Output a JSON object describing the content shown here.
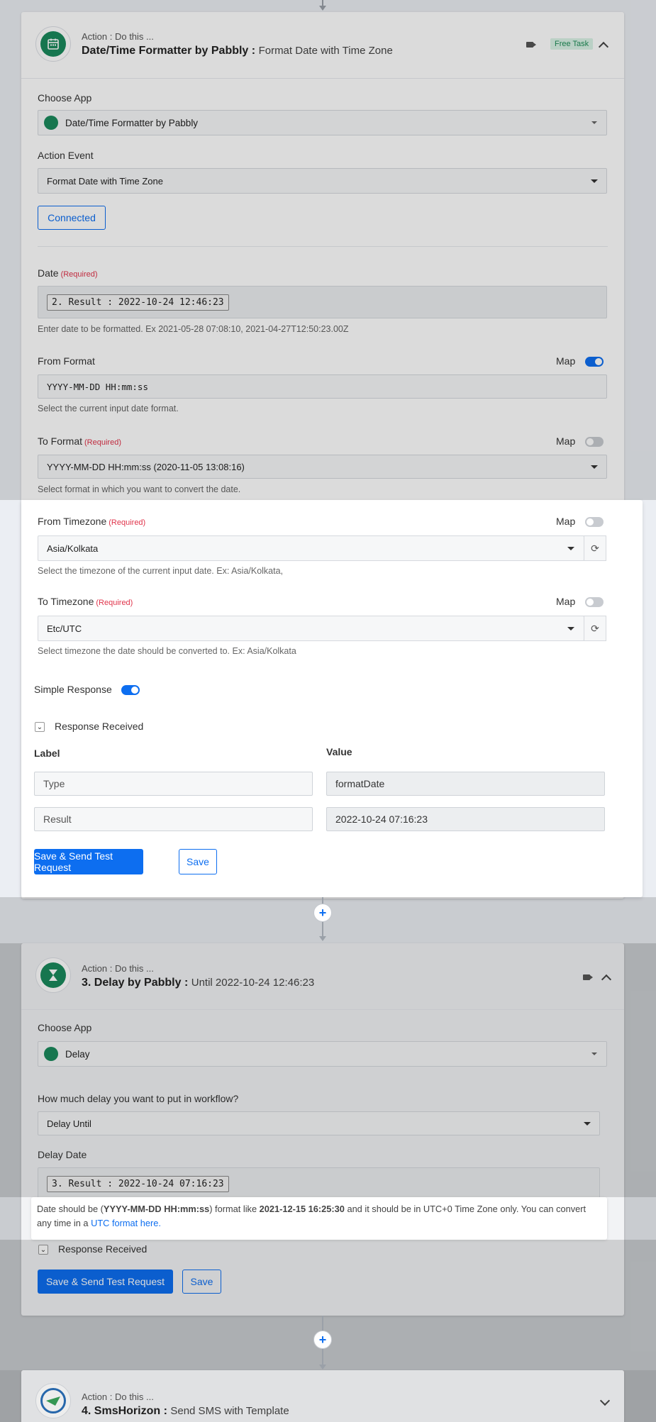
{
  "step1": {
    "subtitle": "Action : Do this ...",
    "title": "Date/Time Formatter by Pabbly :",
    "title_detail": "Format Date with Time Zone",
    "free_task": "Free Task",
    "choose_app_label": "Choose App",
    "app_name": "Date/Time Formatter by Pabbly",
    "action_event_label": "Action Event",
    "action_event_value": "Format Date with Time Zone",
    "connected_label": "Connected",
    "date_label": "Date",
    "required": "(Required)",
    "date_token": "2. Result : 2022-10-24 12:46:23",
    "date_help": "Enter date to be formatted. Ex 2021-05-28 07:08:10, 2021-04-27T12:50:23.00Z",
    "from_format_label": "From Format",
    "map_label": "Map",
    "from_format_value": "YYYY-MM-DD HH:mm:ss",
    "from_format_help": "Select the current input date format.",
    "to_format_label": "To Format",
    "to_format_value": "YYYY-MM-DD HH:mm:ss (2020-11-05 13:08:16)",
    "to_format_help": "Select format in which you want to convert the date.",
    "from_tz_label": "From Timezone",
    "from_tz_value": "Asia/Kolkata",
    "from_tz_help": "Select the timezone of the current input date. Ex: Asia/Kolkata,",
    "to_tz_label": "To Timezone",
    "to_tz_value": "Etc/UTC",
    "to_tz_help": "Select timezone the date should be converted to. Ex: Asia/Kolkata",
    "simple_response_label": "Simple Response",
    "response_received_label": "Response Received",
    "col_label": "Label",
    "col_value": "Value",
    "rows": [
      {
        "label": "Type",
        "value": "formatDate"
      },
      {
        "label": "Result",
        "value": "2022-10-24 07:16:23"
      }
    ],
    "save_send_label": "Save & Send Test Request",
    "save_label": "Save"
  },
  "step2": {
    "subtitle": "Action : Do this ...",
    "title": "3. Delay by Pabbly :",
    "title_detail": "Until 2022-10-24 12:46:23",
    "choose_app_label": "Choose App",
    "app_name": "Delay",
    "question_label": "How much delay you want to put in workflow?",
    "delay_type_value": "Delay Until",
    "delay_date_label": "Delay Date",
    "delay_date_token": "3. Result : 2022-10-24 07:16:23",
    "note_prefix": "Date should be (",
    "note_format": "YYYY-MM-DD HH:mm:ss",
    "note_mid": ") format like ",
    "note_example": "2021-12-15 16:25:30",
    "note_suffix": " and it should be in UTC+0 Time Zone only. You can convert any time in a ",
    "note_link": "UTC format here.",
    "response_received_label": "Response Received",
    "save_send_label": "Save & Send Test Request",
    "save_label": "Save"
  },
  "step3": {
    "subtitle": "Action : Do this ...",
    "title": "4. SmsHorizon :",
    "title_detail": "Send SMS with Template"
  },
  "colors": {
    "accent": "#0d6ef0",
    "brand_green": "#1a8a5c",
    "required_red": "#e0334a"
  }
}
